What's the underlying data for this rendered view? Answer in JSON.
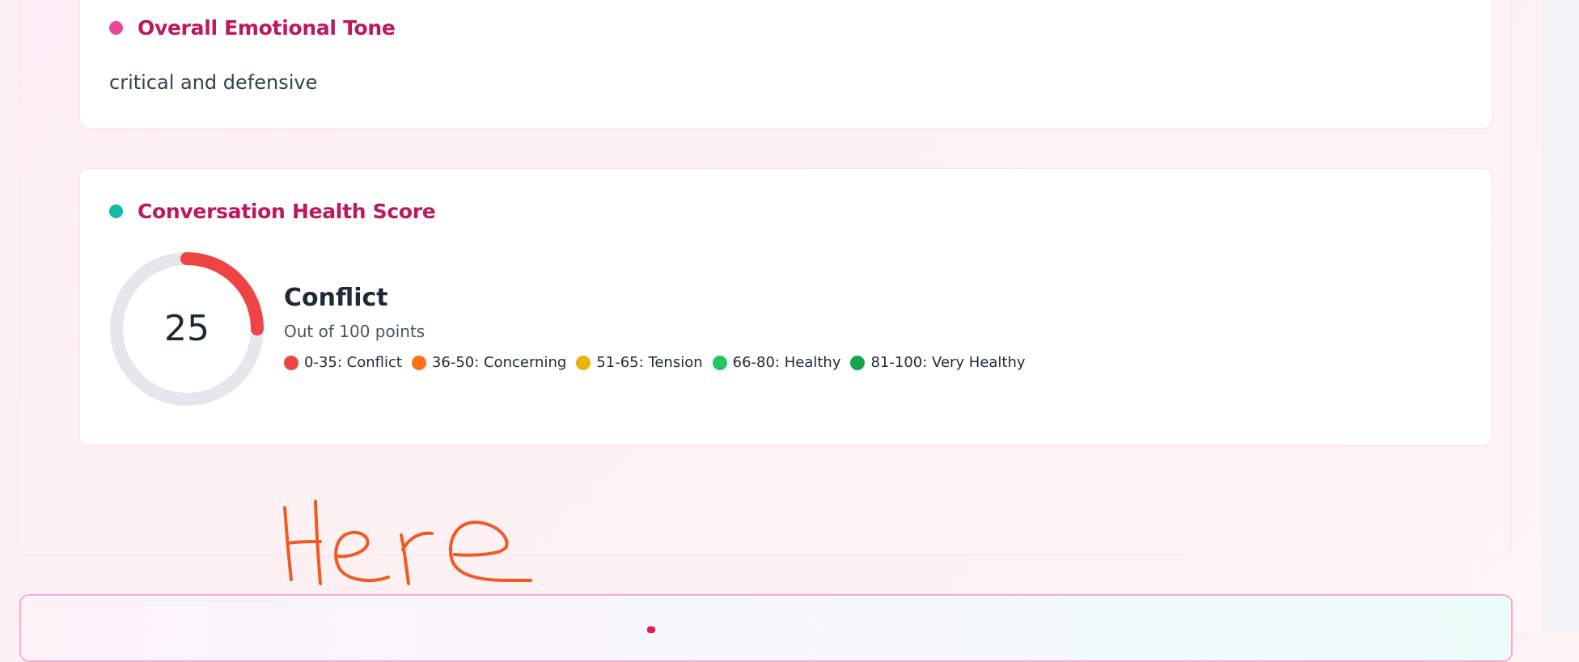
{
  "tone_card": {
    "title": "Overall Emotional Tone",
    "text": "critical and defensive"
  },
  "health_card": {
    "title": "Conversation Health Score",
    "score": 25,
    "score_max": 100,
    "label": "Conflict",
    "subtitle": "Out of 100 points",
    "colors": {
      "arc": "#ef4444",
      "track": "#e5e7eb"
    },
    "legend": [
      {
        "text": "0-35: Conflict",
        "color": "#ef4444"
      },
      {
        "text": "36-50: Concerning",
        "color": "#f97316"
      },
      {
        "text": "51-65: Tension",
        "color": "#eab308"
      },
      {
        "text": "66-80: Healthy",
        "color": "#22c55e"
      },
      {
        "text": "81-100: Very Healthy",
        "color": "#16a34a"
      }
    ]
  },
  "annotation": {
    "text": "Here",
    "color": "#f15a22"
  }
}
